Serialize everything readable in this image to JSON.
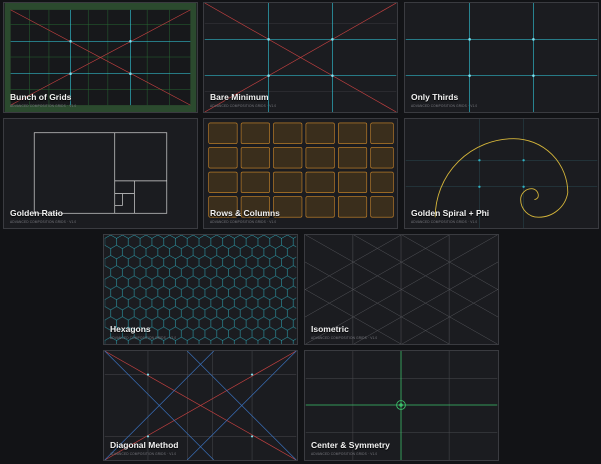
{
  "tiles": [
    {
      "title": "Bunch of Grids",
      "subtitle": "ADVANCED COMPOSITION GRIDS · V1.0"
    },
    {
      "title": "Bare Minimum",
      "subtitle": "ADVANCED COMPOSITION GRIDS · V1.0"
    },
    {
      "title": "Only Thirds",
      "subtitle": "ADVANCED COMPOSITION GRIDS · V1.0"
    },
    {
      "title": "Golden Ratio",
      "subtitle": "ADVANCED COMPOSITION GRIDS · V1.0"
    },
    {
      "title": "Rows & Columns",
      "subtitle": "ADVANCED COMPOSITION GRIDS · V1.0"
    },
    {
      "title": "Golden Spiral + Phi",
      "subtitle": "ADVANCED COMPOSITION GRIDS · V1.0"
    },
    {
      "title": "Hexagons",
      "subtitle": "ADVANCED COMPOSITION GRIDS · V1.0"
    },
    {
      "title": "Isometric",
      "subtitle": "ADVANCED COMPOSITION GRIDS · V1.0"
    },
    {
      "title": "Diagonal Method",
      "subtitle": "ADVANCED COMPOSITION GRIDS · V1.0"
    },
    {
      "title": "Center & Symmetry",
      "subtitle": "ADVANCED COMPOSITION GRIDS · V1.0"
    }
  ],
  "colors": {
    "background": "#121316",
    "tile": "#1b1c20",
    "cyan": "#2fb3c4",
    "red": "#c24040",
    "green": "#2f8a3c",
    "gray": "#6c6d72",
    "orange": "#d08a2a",
    "yellow": "#d6b63a",
    "blue": "#3a6fb8",
    "center_green": "#3cc06a"
  }
}
